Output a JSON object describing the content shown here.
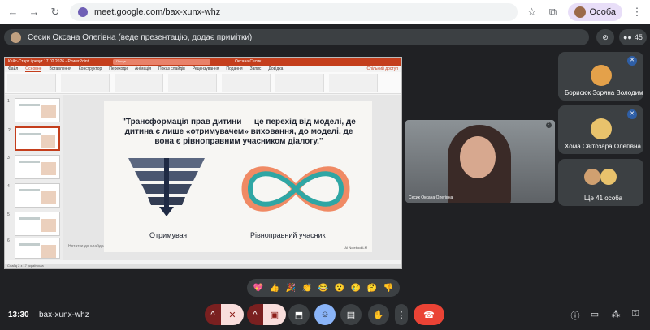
{
  "browser": {
    "url": "meet.google.com/bax-xunx-whz",
    "profile_label": "Особа"
  },
  "presentation_bar": {
    "text": "Сесик Оксана Олегівна (веде презентацію, додає примітки)",
    "participant_count": "45"
  },
  "ppt": {
    "title": "Кейс-Старт і резут 17.02.2026 - PowerPoint",
    "search_placeholder": "Пошук",
    "user": "Оксана Сесик",
    "menu": [
      "Файл",
      "Основне",
      "Вставлення",
      "Конструктор",
      "Переходи",
      "Анімація",
      "Показ слайдів",
      "Рецензування",
      "Подання",
      "Запис",
      "Довідка",
      "Спільний доступ"
    ],
    "notes_placeholder": "Нотатки до слайда",
    "status": "Слайд 2 з 17  українська"
  },
  "slide": {
    "headline": "\"Трансформація прав дитини — це перехід від моделі, де дитина є лише «отримувачем» виховання, до моделі, де вона є рівноправним учасником діалогу.\"",
    "left_label": "Отримувач",
    "right_label": "Рівноправний учасник",
    "watermark": "AI NotebookLM"
  },
  "camera": {
    "name": "Сесик Оксана Олегівна"
  },
  "participants": [
    {
      "name": "Борисюк Зоряна Володим...",
      "avatar_color": "#e4a14a"
    },
    {
      "name": "Хома Світозара Олегівна",
      "avatar_color": "#e8c26c"
    },
    {
      "name": "Ще 41 особа",
      "avatar_color": "#d0a070"
    }
  ],
  "reactions": [
    "💖",
    "👍",
    "🎉",
    "👏",
    "😂",
    "😮",
    "😢",
    "🤔",
    "👎"
  ],
  "bottom": {
    "time": "13:30",
    "meeting_code": "bax-xunx-whz"
  },
  "colors": {
    "ppt_accent": "#c43e1c",
    "end_call": "#ea4335",
    "mic_badge": "#2f5fa6"
  }
}
